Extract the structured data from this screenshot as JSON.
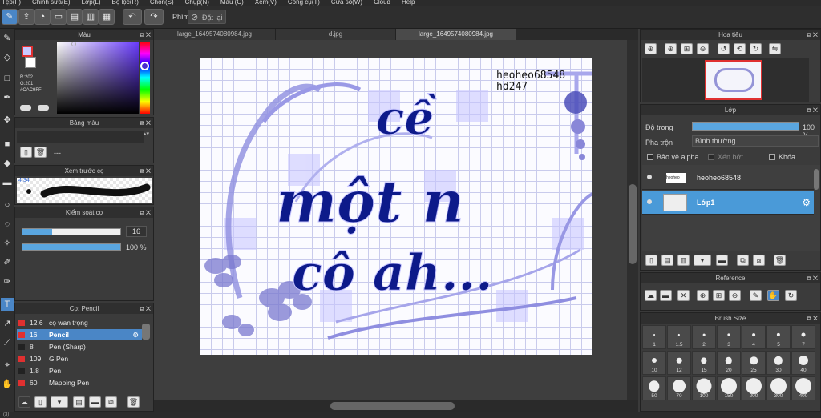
{
  "menu": [
    "Tệp(F)",
    "Chỉnh sửa(E)",
    "Lớp(L)",
    "Bộ lọc(R)",
    "Chọn(S)",
    "Chụp(N)",
    "Màu (C)",
    "Xem(V)",
    "Công cụ(T)",
    "Cửa sổ(W)",
    "Cloud",
    "Help"
  ],
  "toolbar": {
    "pen_label": "Phím",
    "reset_label": "Đặt lại"
  },
  "color_panel": {
    "title": "Màu",
    "r": "R:202",
    "g": "G:201",
    "hex": "#CAC9FF",
    "main_color": "#CAC9FF"
  },
  "palette_panel": {
    "title": "Bảng màu",
    "value": "---"
  },
  "preview_panel": {
    "title": "Xem trước cọ",
    "size": "4.34"
  },
  "brush_control": {
    "title": "Kiểm soát cọ",
    "size": "16",
    "opacity": "100 %",
    "size_fraction": 0.3,
    "opacity_fraction": 1.0
  },
  "brush_list": {
    "title": "Cọ: Pencil",
    "items": [
      {
        "num": "12.6",
        "name": "cọ wan trọng",
        "color": "#e03030"
      },
      {
        "num": "16",
        "name": "Pencil",
        "color": "#e03030",
        "selected": true
      },
      {
        "num": "8",
        "name": "Pen (Sharp)",
        "color": "#222"
      },
      {
        "num": "109",
        "name": "G Pen",
        "color": "#e03030"
      },
      {
        "num": "1.8",
        "name": "Pen",
        "color": "#222"
      },
      {
        "num": "60",
        "name": "Mapping Pen",
        "color": "#e03030"
      }
    ]
  },
  "tabs": [
    {
      "label": "large_1649574080984.jpg"
    },
    {
      "label": "d.jpg"
    },
    {
      "label": "large_1649574080984.jpg",
      "active": true
    }
  ],
  "artwork": {
    "username": "heoheo68548",
    "id": "hd247",
    "line1": "cề",
    "line2": "một n",
    "line3": "cô ah...",
    "ink": "#0d1a8a",
    "fill": "#c6c4ff"
  },
  "navigator": {
    "title": "Hoa tiêu"
  },
  "layer_panel": {
    "title": "Lớp",
    "opacity_label": "Độ trong",
    "opacity": "100 %",
    "blend_label": "Pha trộn",
    "blend": "Bình thường",
    "protect": "Bảo vệ alpha",
    "clip": "Xén bớt",
    "lock": "Khóa",
    "layers": [
      {
        "name": "heoheo68548"
      },
      {
        "name": "Lớp1",
        "selected": true
      }
    ]
  },
  "reference_panel": {
    "title": "Reference"
  },
  "brush_size_panel": {
    "title": "Brush Size",
    "sizes": [
      "1",
      "1.5",
      "2",
      "3",
      "4",
      "5",
      "7",
      "10",
      "12",
      "15",
      "20",
      "25",
      "30",
      "40",
      "50",
      "70",
      "100",
      "150",
      "200",
      "300",
      "400"
    ]
  },
  "status": "(3)"
}
